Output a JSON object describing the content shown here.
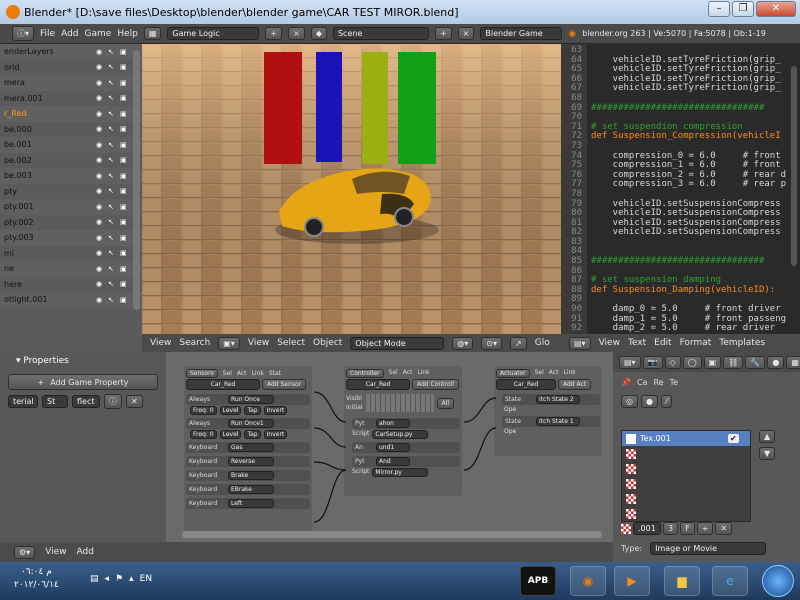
{
  "window": {
    "title": "Blender* [D:\\save files\\Desktop\\blender\\blender game\\CAR TEST MIROR.blend]"
  },
  "menubar": {
    "items": [
      "File",
      "Add",
      "Game",
      "Help"
    ],
    "screen_layout": "Game Logic",
    "scene": "Scene",
    "engine": "Blender Game",
    "stats": "blender.org 263 | Ve:5070 | Fa:5078 | Ob:1-19"
  },
  "outliner": {
    "rows": [
      {
        "label": "enderLayers",
        "selected": false
      },
      {
        "label": "orld",
        "selected": false
      },
      {
        "label": "mera",
        "selected": false
      },
      {
        "label": "mera.001",
        "selected": false
      },
      {
        "label": "r_Red",
        "selected": true
      },
      {
        "label": "be.000",
        "selected": false
      },
      {
        "label": "be.001",
        "selected": false
      },
      {
        "label": "be.002",
        "selected": false
      },
      {
        "label": "be.003",
        "selected": false
      },
      {
        "label": "pty",
        "selected": false
      },
      {
        "label": "pty.001",
        "selected": false
      },
      {
        "label": "pty.002",
        "selected": false
      },
      {
        "label": "pty.003",
        "selected": false
      },
      {
        "label": "mi",
        "selected": false
      },
      {
        "label": "ne",
        "selected": false
      },
      {
        "label": "here",
        "selected": false
      },
      {
        "label": "otlight.001",
        "selected": false
      }
    ]
  },
  "viewport": {
    "menu": [
      "View",
      "Search"
    ],
    "menu2": [
      "View",
      "Select",
      "Object"
    ],
    "mode": "Object Mode",
    "glsl": "Glo",
    "pillar_colors": [
      "#b0100f",
      "#1a14b8",
      "#9bae12",
      "#11a016"
    ],
    "car_color": "#e6a514"
  },
  "text_editor": {
    "lines": [
      {
        "n": "63",
        "code": "",
        "type": "code"
      },
      {
        "n": "64",
        "code": "    vehicleID.setTyreFriction(grip_",
        "type": "code"
      },
      {
        "n": "65",
        "code": "    vehicleID.setTyreFriction(grip_",
        "type": "code"
      },
      {
        "n": "66",
        "code": "    vehicleID.setTyreFriction(grip_",
        "type": "code"
      },
      {
        "n": "67",
        "code": "    vehicleID.setTyreFriction(grip_",
        "type": "code"
      },
      {
        "n": "68",
        "code": "",
        "type": "code"
      },
      {
        "n": "69",
        "code": "################################",
        "type": "cm"
      },
      {
        "n": "70",
        "code": "",
        "type": "code"
      },
      {
        "n": "71",
        "code": "# set suspendion compression",
        "type": "cm"
      },
      {
        "n": "72",
        "code": "def Suspension_Compression(vehicleI",
        "type": "kw"
      },
      {
        "n": "73",
        "code": "",
        "type": "code"
      },
      {
        "n": "74",
        "code": "    compression_0 = 6.0     # front",
        "type": "code"
      },
      {
        "n": "75",
        "code": "    compression_1 = 6.0     # front",
        "type": "code"
      },
      {
        "n": "76",
        "code": "    compression_2 = 6.0     # rear d",
        "type": "code"
      },
      {
        "n": "77",
        "code": "    compression_3 = 6.0     # rear p",
        "type": "code"
      },
      {
        "n": "78",
        "code": "",
        "type": "code"
      },
      {
        "n": "79",
        "code": "    vehicleID.setSuspensionCompress",
        "type": "code"
      },
      {
        "n": "80",
        "code": "    vehicleID.setSuspensionCompress",
        "type": "code"
      },
      {
        "n": "81",
        "code": "    vehicleID.setSuspensionCompress",
        "type": "code"
      },
      {
        "n": "82",
        "code": "    vehicleID.setSuspensionCompress",
        "type": "code"
      },
      {
        "n": "83",
        "code": "",
        "type": "code"
      },
      {
        "n": "84",
        "code": "",
        "type": "code"
      },
      {
        "n": "85",
        "code": "################################",
        "type": "cm"
      },
      {
        "n": "86",
        "code": "",
        "type": "code"
      },
      {
        "n": "87",
        "code": "# set suspension damping",
        "type": "cm"
      },
      {
        "n": "88",
        "code": "def Suspension_Damping(vehicleID):",
        "type": "kw"
      },
      {
        "n": "89",
        "code": "",
        "type": "code"
      },
      {
        "n": "90",
        "code": "    damp_0 = 5.0     # front driver",
        "type": "code"
      },
      {
        "n": "91",
        "code": "    damp_1 = 5.0     # front passeng",
        "type": "code"
      },
      {
        "n": "92",
        "code": "    damp_2 = 5.0     # rear driver",
        "type": "code"
      }
    ],
    "menu": [
      "View",
      "Text",
      "Edit",
      "Format",
      "Templates"
    ]
  },
  "properties": {
    "title": "Properties",
    "add_button": "Add Game Property",
    "prop_name": "terial",
    "prop_type": "St",
    "prop_value": "flect"
  },
  "logic": {
    "sensors": {
      "title": "Sensors",
      "object": "Car_Red",
      "add": "Add Sensor",
      "toggles": [
        "Sel",
        "Act",
        "Link",
        "Stat"
      ],
      "items": [
        {
          "type": "Always",
          "name": "Run Once"
        },
        {
          "type": "Always",
          "name": "Run Once1"
        },
        {
          "type": "Keyboard",
          "name": "Gas"
        },
        {
          "type": "Keyboard",
          "name": "Reverse"
        },
        {
          "type": "Keyboard",
          "name": "Brake"
        },
        {
          "type": "Keyboard",
          "name": "EBrake"
        },
        {
          "type": "Keyboard",
          "name": "Left"
        }
      ],
      "freq": "Freq: 0",
      "level": "Level",
      "tap": "Tap",
      "invert": "Invert"
    },
    "controllers": {
      "title": "Controller",
      "object": "Car_Red",
      "add": "Add Controll",
      "toggles": [
        "Sel",
        "Act",
        "Link"
      ],
      "visible": "Visibl",
      "initial": "Initial",
      "all": "All",
      "items": [
        {
          "type": "Pyt",
          "name": "ahon",
          "script": "CarSetup.py"
        },
        {
          "type": "An",
          "name": "und1"
        },
        {
          "type": "Pyt",
          "name": "And",
          "script": "Mirror.py"
        }
      ],
      "script_label": "Script"
    },
    "actuators": {
      "title": "Actuator",
      "object": "Car_Red",
      "add": "Add Act",
      "toggles": [
        "Sel",
        "Act",
        "Link"
      ],
      "items": [
        {
          "type": "State",
          "name": "itch State 2",
          "op": "Ope"
        },
        {
          "type": "State",
          "name": "itch State 1",
          "op": "Ope"
        }
      ]
    }
  },
  "bottom_bar": {
    "menu": [
      "View",
      "Add"
    ]
  },
  "texture_panel": {
    "tabs": [
      "Ca",
      "Re",
      "Te"
    ],
    "slots": [
      {
        "name": "Tex.001",
        "checked": true
      },
      {
        "name": "",
        "checked": false
      },
      {
        "name": "",
        "checked": false
      },
      {
        "name": "",
        "checked": false
      },
      {
        "name": "",
        "checked": false
      },
      {
        "name": "",
        "checked": false
      }
    ],
    "tex_name": ".001",
    "users": "3",
    "fake": "F",
    "type_label": "Type:",
    "type_value": "Image or Movie"
  },
  "taskbar": {
    "time": "م ٠٦:٠٤",
    "date": "٢٠١٢/٠٦/١٤",
    "lang": "EN",
    "apps": [
      "APB",
      "Blender",
      "Media",
      "Explorer",
      "IE",
      "Start"
    ]
  }
}
